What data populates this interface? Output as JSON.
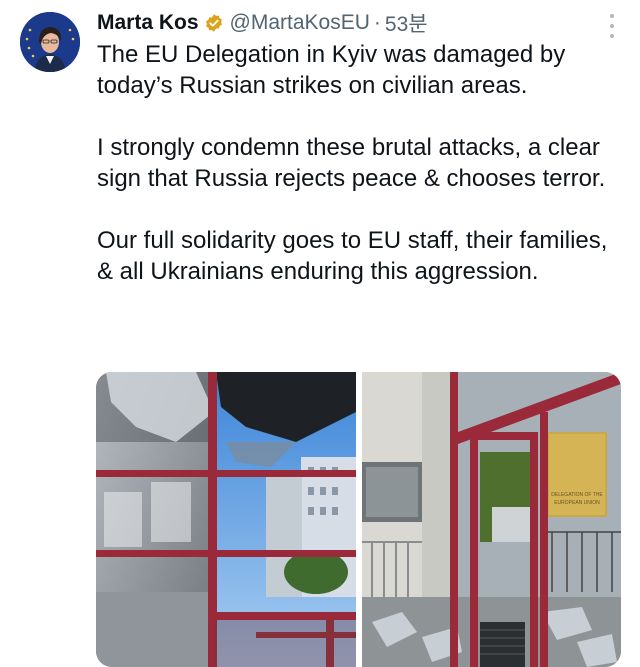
{
  "tweet": {
    "author_name": "Marta Kos",
    "handle": "@MartaKosEU",
    "separator": "·",
    "time": "53분",
    "paragraphs": [
      "The EU Delegation in Kyiv was damaged by today’s Russian strikes on civilian areas.",
      "I strongly condemn these brutal attacks, a clear sign that Russia rejects peace & chooses terror.",
      "Our full solidarity goes to EU staff, their families, & all Ukrainians enduring this aggression."
    ]
  },
  "icons": {
    "verified": "verified-badge-icon",
    "more": "more-options-icon"
  },
  "media": {
    "photo_1": "damaged-building-windows",
    "photo_2": "damaged-entrance-door",
    "plaque_text": "DELEGATION OF THE EUROPEAN UNION"
  },
  "colors": {
    "text_primary": "#0f1419",
    "text_secondary": "#536471",
    "verified_badge": "#d9a41c",
    "eu_blue": "#1b3a8c",
    "window_frame": "#9a2a3a"
  }
}
